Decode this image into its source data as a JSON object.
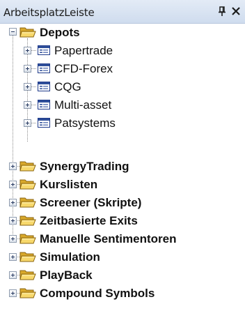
{
  "panel": {
    "title": "ArbeitsplatzLeiste",
    "pin_icon": "pin-icon",
    "close_icon": "close-icon"
  },
  "tree": {
    "root": {
      "label": "Depots",
      "state": "expanded",
      "icon": "folder-icon",
      "children": [
        {
          "label": "Papertrade",
          "icon": "depot-icon",
          "state": "collapsed"
        },
        {
          "label": "CFD-Forex",
          "icon": "depot-icon",
          "state": "collapsed"
        },
        {
          "label": "CQG",
          "icon": "depot-icon",
          "state": "collapsed"
        },
        {
          "label": "Multi-asset",
          "icon": "depot-icon",
          "state": "collapsed"
        },
        {
          "label": "Patsystems",
          "icon": "depot-icon",
          "state": "collapsed"
        }
      ]
    },
    "folders": [
      {
        "label": "SynergyTrading",
        "state": "collapsed"
      },
      {
        "label": "Kurslisten",
        "state": "collapsed"
      },
      {
        "label": "Screener (Skripte)",
        "state": "collapsed"
      },
      {
        "label": "Zeitbasierte Exits",
        "state": "collapsed"
      },
      {
        "label": "Manuelle Sentimentoren",
        "state": "collapsed"
      },
      {
        "label": "Simulation",
        "state": "collapsed"
      },
      {
        "label": "PlayBack",
        "state": "collapsed"
      },
      {
        "label": "Compound Symbols",
        "state": "collapsed"
      }
    ]
  },
  "colors": {
    "titlebar": "#d9e4f2",
    "folder": "#f2c94c",
    "depot_icon": "#2f4f9a"
  }
}
